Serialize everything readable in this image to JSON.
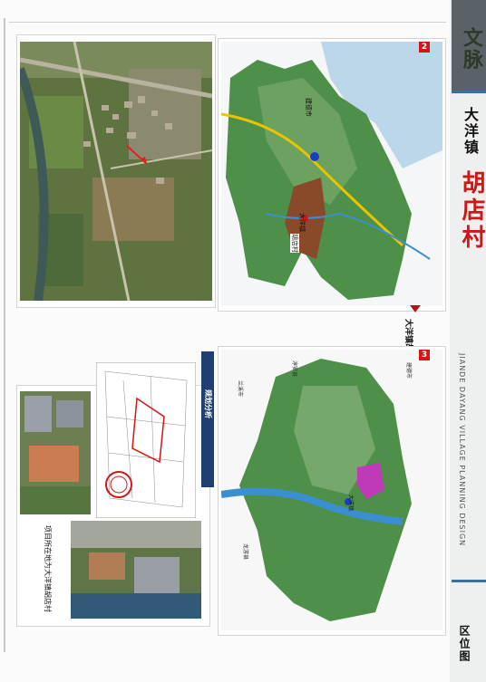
{
  "header": {
    "series_label": "文脉",
    "town": "大洋镇",
    "village": "胡店村"
  },
  "panels": {
    "location": {
      "number": "2",
      "caption": "大洋镇胡店村区位位置",
      "map_labels": [
        "建德市",
        "大洋镇",
        "胡店村"
      ]
    },
    "planning": {
      "number": "3",
      "caption": "规划分析",
      "county_labels": [
        "淳安县",
        "兰溪市",
        "龙游县",
        "建德市"
      ],
      "river_label": "大洋镇"
    },
    "photos": {
      "caption": "项目所在地为大洋镇胡店村"
    }
  },
  "footer": {
    "section_title": "区位图",
    "subtitle_en": "JIANDE DAYANG VILLAGE PLANNING DESIGN"
  },
  "colors": {
    "accent_red": "#d21515",
    "band_dark": "#5a6268",
    "rule_blue": "#3a6ea5",
    "terrain_green": "#4e8f4a",
    "village_brown": "#8a4a2a",
    "plot_magenta": "#c03ab8",
    "river_blue": "#3b8fd0"
  }
}
